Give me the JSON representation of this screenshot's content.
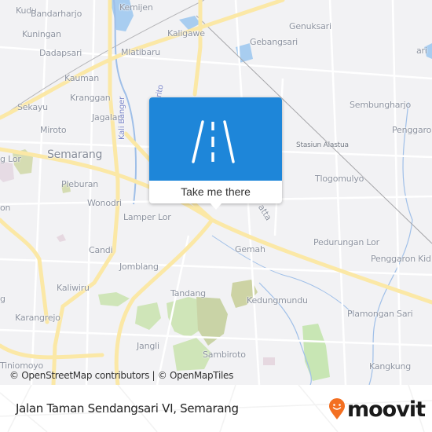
{
  "map": {
    "attribution": "© OpenStreetMap contributors | © OpenMapTiles",
    "labels": [
      {
        "id": "bandarharjo",
        "text": "Bandarharjo",
        "class": ""
      },
      {
        "id": "kemijen",
        "text": "Kemijen",
        "class": ""
      },
      {
        "id": "kuningan",
        "text": "Kuningan",
        "class": ""
      },
      {
        "id": "kaligawe",
        "text": "Kaligawe",
        "class": ""
      },
      {
        "id": "genuksari",
        "text": "Genuksari",
        "class": ""
      },
      {
        "id": "gebangsari",
        "text": "Gebangsari",
        "class": ""
      },
      {
        "id": "dadapsari",
        "text": "Dadapsari",
        "class": ""
      },
      {
        "id": "mlatibaru",
        "text": "Mlatibaru",
        "class": ""
      },
      {
        "id": "kauman",
        "text": "Kauman",
        "class": ""
      },
      {
        "id": "kranggan",
        "text": "Kranggan",
        "class": ""
      },
      {
        "id": "sekayu",
        "text": "Sekayu",
        "class": ""
      },
      {
        "id": "jagalan",
        "text": "Jagalan",
        "class": ""
      },
      {
        "id": "miroto",
        "text": "Miroto",
        "class": ""
      },
      {
        "id": "semarang",
        "text": "Semarang",
        "class": "big"
      },
      {
        "id": "pleburan",
        "text": "Pleburan",
        "class": ""
      },
      {
        "id": "wonodri",
        "text": "Wonodri",
        "class": ""
      },
      {
        "id": "lamper-lor",
        "text": "Lamper Lor",
        "class": ""
      },
      {
        "id": "candi",
        "text": "Candi",
        "class": ""
      },
      {
        "id": "jomblang",
        "text": "Jomblang",
        "class": ""
      },
      {
        "id": "kaliwiru",
        "text": "Kaliwiru",
        "class": ""
      },
      {
        "id": "karangrejo",
        "text": "Karangrejo",
        "class": ""
      },
      {
        "id": "tandang",
        "text": "Tandang",
        "class": ""
      },
      {
        "id": "jangli",
        "text": "Jangli",
        "class": ""
      },
      {
        "id": "sambiroto",
        "text": "Sambiroto",
        "class": ""
      },
      {
        "id": "kedungmundu",
        "text": "Kedungmundu",
        "class": ""
      },
      {
        "id": "gemah",
        "text": "Gemah",
        "class": ""
      },
      {
        "id": "pedurungan-lor",
        "text": "Pedurungan Lor",
        "class": ""
      },
      {
        "id": "penggaron-kidul",
        "text": "Penggaron Kid",
        "class": ""
      },
      {
        "id": "plamongan-sari",
        "text": "Plamongan Sari",
        "class": ""
      },
      {
        "id": "kangkung",
        "text": "Kangkung",
        "class": ""
      },
      {
        "id": "tlogomulyo",
        "text": "Tlogomulyo",
        "class": ""
      },
      {
        "id": "stasiun-alastua",
        "text": "Stasiun Alastua",
        "class": "small"
      },
      {
        "id": "sembungharjo",
        "text": "Sembungharjo",
        "class": ""
      },
      {
        "id": "penggaron",
        "text": "Penggaro",
        "class": ""
      },
      {
        "id": "kudu",
        "text": "Kudu",
        "class": ""
      },
      {
        "id": "ng-lor",
        "text": "g Lor",
        "class": ""
      },
      {
        "id": "ari",
        "text": "ari",
        "class": ""
      },
      {
        "id": "on",
        "text": "on",
        "class": ""
      },
      {
        "id": "g",
        "text": "g",
        "class": ""
      },
      {
        "id": "tiniomoyo",
        "text": "Tiniomoyo",
        "class": ""
      },
      {
        "id": "kali-banger",
        "text": "Kali Banger",
        "class": "water"
      },
      {
        "id": "arito",
        "text": "rito",
        "class": "water"
      },
      {
        "id": "atta",
        "text": "atta",
        "class": ""
      }
    ]
  },
  "popup": {
    "icon": "road-icon",
    "button_label": "Take me there",
    "accent_color": "#1e86d9"
  },
  "footer": {
    "location": "Jalan Taman Sendangsari VI, Semarang",
    "brand": "moovit",
    "brand_color": "#f36f21"
  }
}
